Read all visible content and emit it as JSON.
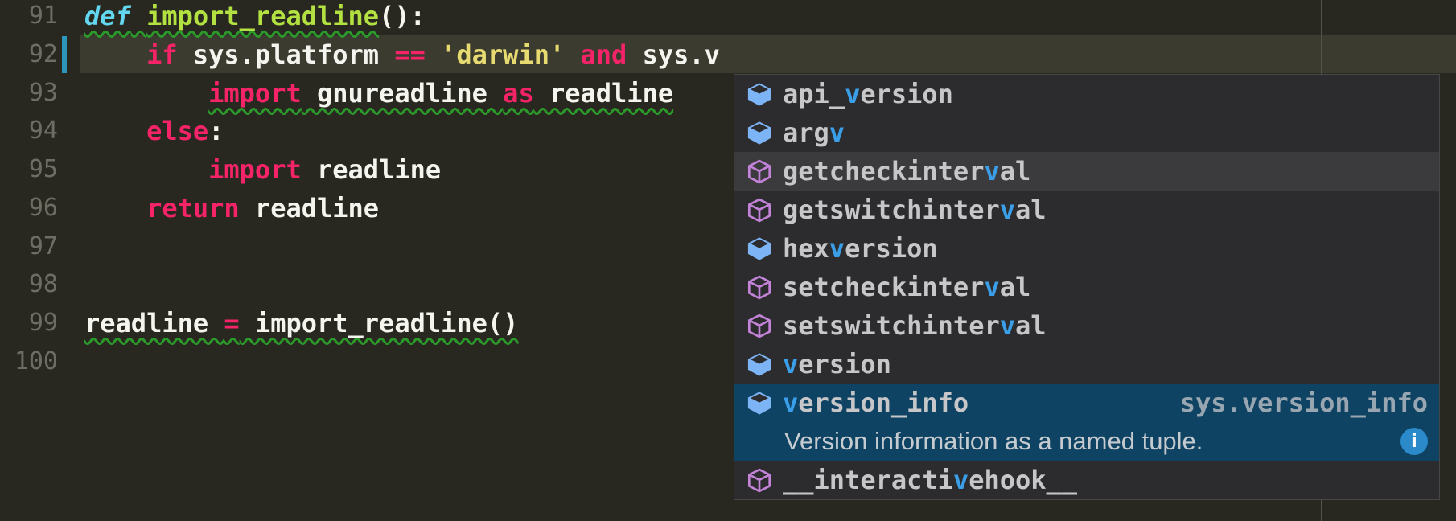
{
  "colors": {
    "editor-bg": "#282820",
    "line-highlight": "#3c3b30",
    "gutter-fg": "#6e6c63",
    "code-fg": "#f5f5ef",
    "keyword": "#f52367",
    "keyword-def": "#63d7ef",
    "function-name": "#b3e141",
    "string": "#e7da70",
    "squiggle": "#2b9a2b",
    "ruler": "#53524b",
    "gutter-bar": "#2d96bd",
    "ac-bg": "#2c2c2f",
    "ac-border": "#47474a",
    "hover": "#3b3b3e",
    "selected": "#0f4364",
    "item-fg": "#c7c7c9",
    "match": "#3a9fe8",
    "annotation": "#98a6b1",
    "detail-fg": "#c6cbd0",
    "icon-blue": "#7db4f5",
    "icon-purple": "#c383d8",
    "info": "#2b8ac9"
  },
  "editor": {
    "current_line": "92",
    "typed_prefix": "v",
    "lines": [
      {
        "number": "91",
        "segments": [
          {
            "t": "def",
            "c": "kw2",
            "sq": true
          },
          {
            "t": " ",
            "sq": true
          },
          {
            "t": "import_readline",
            "c": "fn",
            "sq": true
          },
          {
            "t": "():"
          }
        ]
      },
      {
        "number": "92",
        "highlighted": true,
        "segments": [
          {
            "t": "    "
          },
          {
            "t": "if",
            "c": "kw"
          },
          {
            "t": " sys.platform "
          },
          {
            "t": "==",
            "c": "kw"
          },
          {
            "t": " "
          },
          {
            "t": "'darwin'",
            "c": "str"
          },
          {
            "t": " "
          },
          {
            "t": "and",
            "c": "kw"
          },
          {
            "t": " sys.v"
          }
        ]
      },
      {
        "number": "93",
        "segments": [
          {
            "t": "        "
          },
          {
            "t": "import",
            "c": "kw",
            "sq": true
          },
          {
            "t": " gnureadline ",
            "sq": true
          },
          {
            "t": "as",
            "c": "kw",
            "sq": true
          },
          {
            "t": " readline",
            "sq": true
          }
        ]
      },
      {
        "number": "94",
        "segments": [
          {
            "t": "    "
          },
          {
            "t": "else",
            "c": "kw"
          },
          {
            "t": ":"
          }
        ]
      },
      {
        "number": "95",
        "segments": [
          {
            "t": "        "
          },
          {
            "t": "import",
            "c": "kw"
          },
          {
            "t": " readline"
          }
        ]
      },
      {
        "number": "96",
        "segments": [
          {
            "t": "    "
          },
          {
            "t": "return",
            "c": "kw"
          },
          {
            "t": " readline"
          }
        ]
      },
      {
        "number": "97",
        "segments": []
      },
      {
        "number": "98",
        "segments": []
      },
      {
        "number": "99",
        "segments": [
          {
            "t": "readline ",
            "sq": true
          },
          {
            "t": "=",
            "c": "kw",
            "sq": true
          },
          {
            "t": " import_readline()",
            "sq": true
          }
        ]
      },
      {
        "number": "100",
        "segments": []
      }
    ]
  },
  "autocomplete": {
    "items": [
      {
        "pre": "api_",
        "match": "v",
        "post": "ersion",
        "kind": "attribute"
      },
      {
        "pre": "arg",
        "match": "v",
        "post": "",
        "kind": "attribute"
      },
      {
        "pre": "getcheckinter",
        "match": "v",
        "post": "al",
        "kind": "function",
        "hovered": true
      },
      {
        "pre": "getswitchinter",
        "match": "v",
        "post": "al",
        "kind": "function"
      },
      {
        "pre": "hex",
        "match": "v",
        "post": "ersion",
        "kind": "attribute"
      },
      {
        "pre": "setcheckinter",
        "match": "v",
        "post": "al",
        "kind": "function"
      },
      {
        "pre": "setswitchinter",
        "match": "v",
        "post": "al",
        "kind": "function"
      },
      {
        "pre": "",
        "match": "v",
        "post": "ersion",
        "kind": "attribute"
      },
      {
        "pre": "",
        "match": "v",
        "post": "ersion_info",
        "kind": "attribute",
        "selected": true,
        "annotation": "sys.version_info",
        "detail": "Version information as a named tuple.",
        "info_icon": "i"
      },
      {
        "pre": "__interacti",
        "match": "v",
        "post": "ehook__",
        "kind": "function"
      }
    ]
  }
}
